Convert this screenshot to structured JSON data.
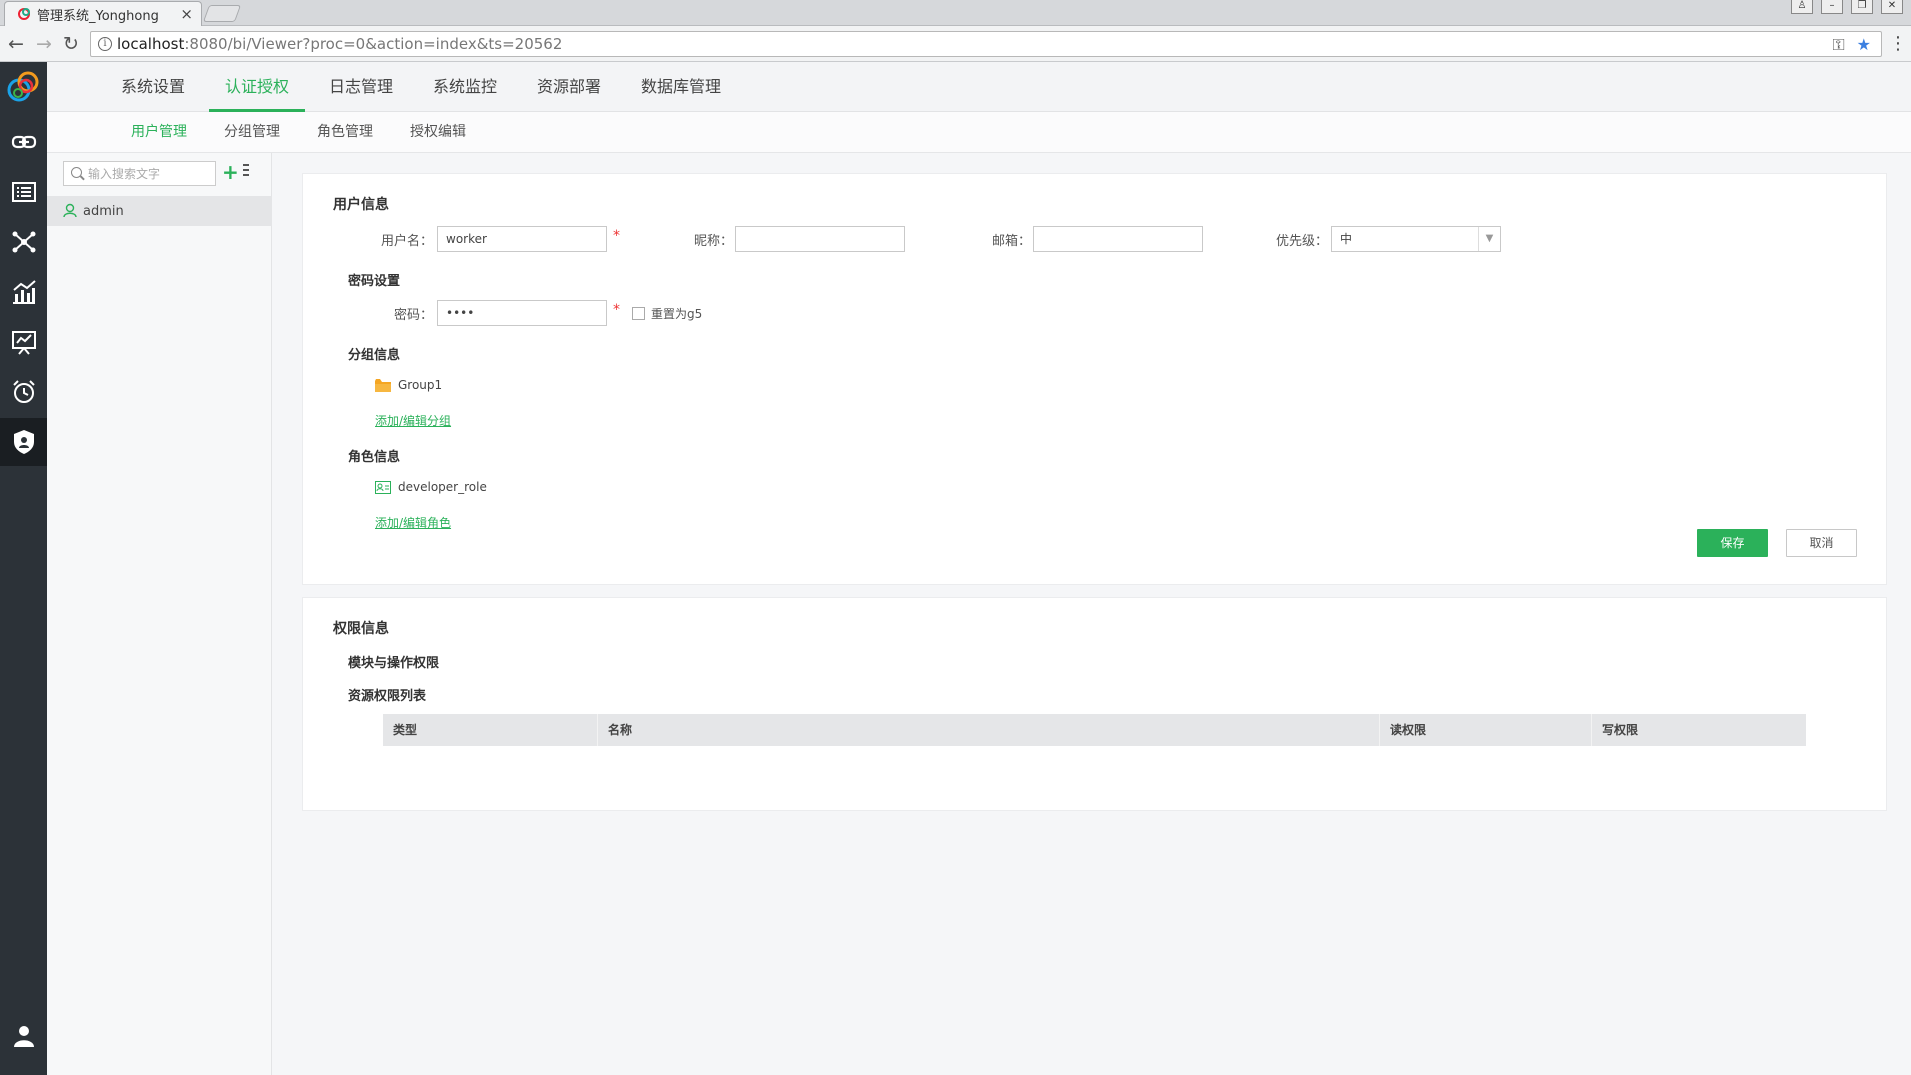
{
  "browser": {
    "tab_title": "管理系统_Yonghong",
    "url_host": "localhost",
    "url_rest": ":8080/bi/Viewer?proc=0&action=index&ts=20562"
  },
  "rail": {
    "items": [
      "link-icon",
      "list-icon",
      "network-icon",
      "chart-icon",
      "presentation-icon",
      "alarm-icon",
      "shield-user-icon",
      "user-icon"
    ],
    "active": "shield-user-icon"
  },
  "topnav": {
    "items": [
      "系统设置",
      "认证授权",
      "日志管理",
      "系统监控",
      "资源部署",
      "数据库管理"
    ],
    "active": "认证授权"
  },
  "subnav": {
    "items": [
      "用户管理",
      "分组管理",
      "角色管理",
      "授权编辑"
    ],
    "active": "用户管理"
  },
  "left_panel": {
    "search_placeholder": "输入搜索文字",
    "users": [
      "admin"
    ]
  },
  "user_info": {
    "title": "用户信息",
    "username_label": "用户名：",
    "username_value": "worker",
    "nickname_label": "昵称：",
    "nickname_value": "",
    "email_label": "邮箱：",
    "email_value": "",
    "priority_label": "优先级：",
    "priority_value": "中",
    "password_section": "密码设置",
    "password_label": "密码：",
    "password_value": "••••",
    "reset_label": "重置为g5",
    "group_section": "分组信息",
    "groups": [
      "Group1"
    ],
    "edit_group_link": "添加/编辑分组",
    "role_section": "角色信息",
    "roles": [
      "developer_role"
    ],
    "edit_role_link": "添加/编辑角色",
    "save_label": "保存",
    "cancel_label": "取消"
  },
  "permissions": {
    "title": "权限信息",
    "module_section": "模块与操作权限",
    "resource_section": "资源权限列表",
    "columns": [
      "类型",
      "名称",
      "读权限",
      "写权限"
    ]
  },
  "colors": {
    "accent": "#2bb15a",
    "rail": "#2c3238"
  }
}
